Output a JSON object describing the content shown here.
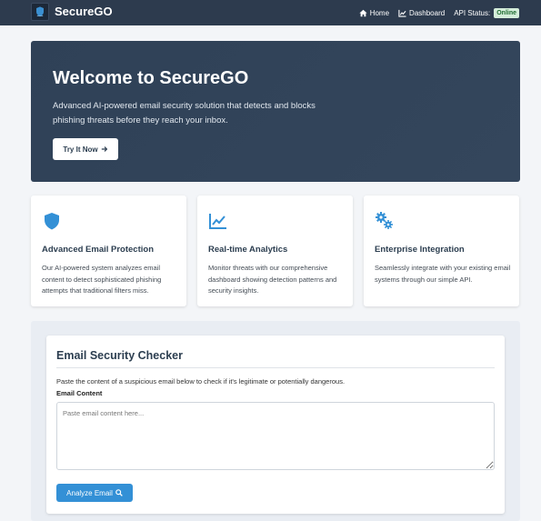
{
  "navbar": {
    "brand": "SecureGO",
    "links": [
      {
        "label": "Home",
        "icon": "home-icon"
      },
      {
        "label": "Dashboard",
        "icon": "chart-line-icon"
      }
    ],
    "api_status_label": "API Status:",
    "api_status_value": "Online",
    "api_status_color": "#d4edda"
  },
  "hero": {
    "title": "Welcome to SecureGO",
    "description": "Advanced AI-powered email security solution that detects and blocks phishing threats before they reach your inbox.",
    "button_label": "Try It Now",
    "button_icon": "arrow-right-icon"
  },
  "features": [
    {
      "icon": "shield-icon",
      "title": "Advanced Email Protection",
      "text": "Our AI-powered system analyzes email content to detect sophisticated phishing attempts that traditional filters miss."
    },
    {
      "icon": "chart-line-icon",
      "title": "Real-time Analytics",
      "text": "Monitor threats with our comprehensive dashboard showing detection patterns and security insights."
    },
    {
      "icon": "cogs-icon",
      "title": "Enterprise Integration",
      "text": "Seamlessly integrate with your existing email systems through our simple API."
    }
  ],
  "checker": {
    "title": "Email Security Checker",
    "description": "Paste the content of a suspicious email below to check if it's legitimate or potentially dangerous.",
    "field_label": "Email Content",
    "placeholder": "Paste email content here...",
    "value": "",
    "button_label": "Analyze Email",
    "button_icon": "search-icon"
  },
  "colors": {
    "navbar": "#2d3b4e",
    "accent": "#3390d6",
    "hero": "#2f4157"
  }
}
